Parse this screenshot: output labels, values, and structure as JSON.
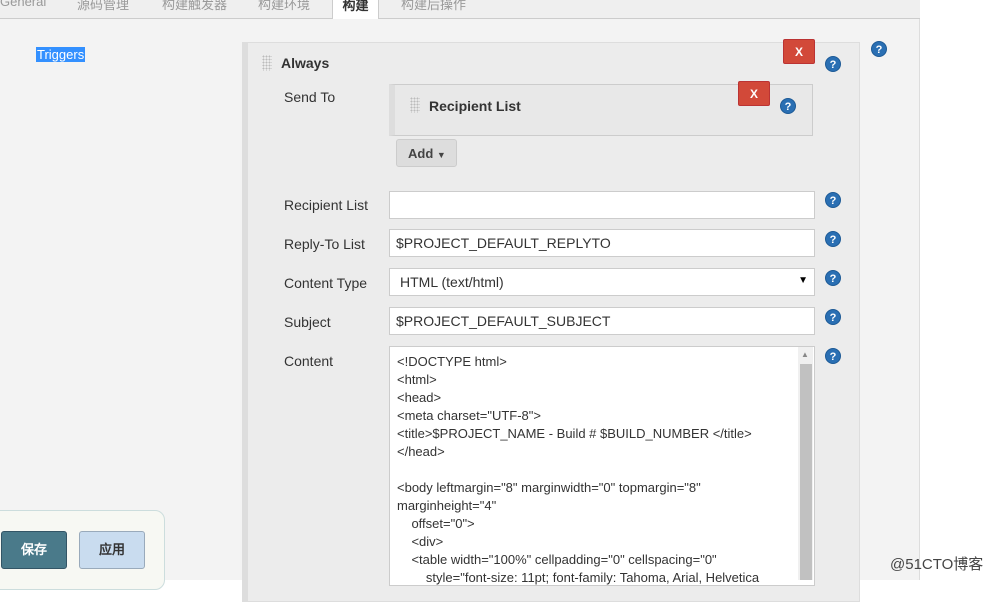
{
  "tabs": [
    "General",
    "源码管理",
    "构建触发器",
    "构建环境",
    "构建",
    "构建后操作"
  ],
  "active_tab": "构建",
  "section_label": "Triggers",
  "trigger": {
    "title": "Always",
    "delete_label": "X",
    "send_to_label": "Send To",
    "recipient_block": {
      "title": "Recipient List",
      "delete_label": "X"
    },
    "add_label": "Add"
  },
  "fields": [
    {
      "label": "Recipient List",
      "value": ""
    },
    {
      "label": "Reply-To List",
      "value": "$PROJECT_DEFAULT_REPLYTO"
    },
    {
      "label": "Content Type",
      "value": "HTML (text/html)"
    },
    {
      "label": "Subject",
      "value": "$PROJECT_DEFAULT_SUBJECT"
    }
  ],
  "content": {
    "label": "Content",
    "value": "<!DOCTYPE html>\n<html>\n<head>\n<meta charset=\"UTF-8\">\n<title>$PROJECT_NAME - Build # $BUILD_NUMBER </title>\n</head>\n\n<body leftmargin=\"8\" marginwidth=\"0\" topmargin=\"8\"\nmarginheight=\"4\"\n    offset=\"0\">\n    <div>\n    <table width=\"100%\" cellpadding=\"0\" cellspacing=\"0\"\n        style=\"font-size: 11pt; font-family: Tahoma, Arial, Helvetica"
  },
  "help_glyph": "?",
  "buttons": {
    "save": "保存",
    "apply": "应用"
  },
  "watermark": "@51CTO博客",
  "colors": {
    "delete": "#d24939",
    "save": "#4a7a8a",
    "apply": "#c9dcef",
    "help": "#2a6fb3",
    "selection": "#3390ff"
  }
}
